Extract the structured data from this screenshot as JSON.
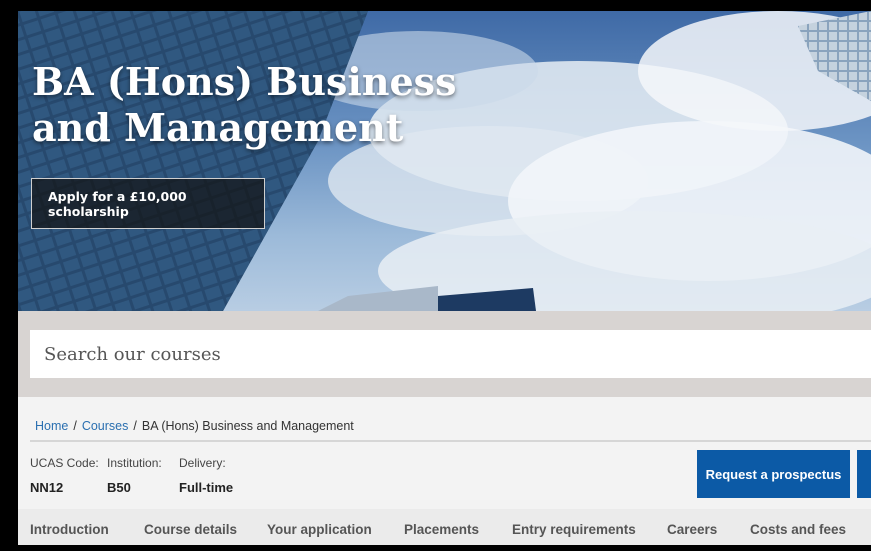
{
  "hero": {
    "title_line1": "BA (Hons) Business",
    "title_line2": "and Management",
    "scholarship_button": "Apply for a £10,000 scholarship"
  },
  "search": {
    "placeholder": "Search our courses"
  },
  "breadcrumb": {
    "home": "Home",
    "courses": "Courses",
    "current": "BA (Hons) Business and Management",
    "separator": "/"
  },
  "course_info": {
    "ucas_label": "UCAS Code:",
    "ucas_value": "NN12",
    "institution_label": "Institution:",
    "institution_value": "B50",
    "delivery_label": "Delivery:",
    "delivery_value": "Full-time"
  },
  "actions": {
    "prospectus": "Request a prospectus"
  },
  "tabs": [
    {
      "label": "Introduction"
    },
    {
      "label": "Course details"
    },
    {
      "label": "Your application"
    },
    {
      "label": "Placements"
    },
    {
      "label": "Entry requirements"
    },
    {
      "label": "Careers"
    },
    {
      "label": "Costs and fees"
    }
  ],
  "colors": {
    "primary_button": "#0c5aa6",
    "link": "#2a6fb0",
    "search_band": "#d8d4d2"
  }
}
